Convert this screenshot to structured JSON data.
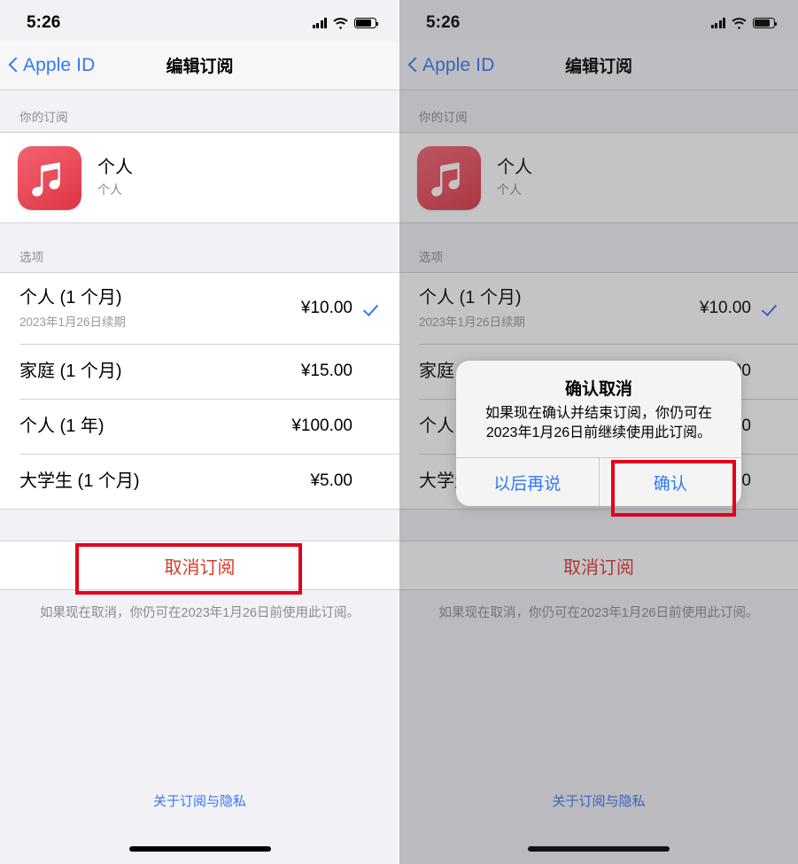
{
  "colors": {
    "accent_blue": "#3478f6",
    "destructive_red": "#d9372b",
    "annotation_red": "#e3001b",
    "icon_red": "#eb4f5d",
    "header_gray": "#8b8b90"
  },
  "status_bar": {
    "time": "5:26",
    "signal_icon": "cellular-signal-icon",
    "wifi_icon": "wifi-icon",
    "battery_icon": "battery-icon"
  },
  "nav": {
    "back_label": "Apple ID",
    "back_icon": "chevron-left-icon",
    "title": "编辑订阅"
  },
  "sections": {
    "subscription_header": "你的订阅",
    "options_header": "选项"
  },
  "subscription": {
    "app_icon": "apple-music-icon",
    "title": "个人",
    "subtitle": "个人"
  },
  "options": [
    {
      "name": "个人 (1 个月)",
      "renewal": "2023年1月26日续期",
      "price": "¥10.00",
      "selected": true
    },
    {
      "name": "家庭 (1 个月)",
      "renewal": "",
      "price": "¥15.00",
      "selected": false
    },
    {
      "name": "个人 (1 年)",
      "renewal": "",
      "price": "¥100.00",
      "selected": false
    },
    {
      "name": "大学生 (1 个月)",
      "renewal": "",
      "price": "¥5.00",
      "selected": false
    }
  ],
  "cancel": {
    "label": "取消订阅",
    "note": "如果现在取消，你仍可在2023年1月26日前使用此订阅。"
  },
  "footer": {
    "link": "关于订阅与隐私"
  },
  "alert": {
    "title": "确认取消",
    "message": "如果现在确认并结束订阅，你仍可在\n2023年1月26日前继续使用此订阅。",
    "later_label": "以后再说",
    "confirm_label": "确认"
  }
}
